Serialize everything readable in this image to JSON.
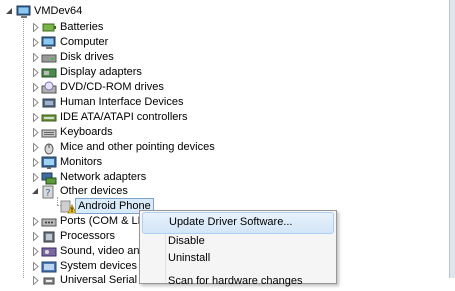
{
  "tree": {
    "root": {
      "label": "VMDev64",
      "icon": "computer-icon"
    },
    "items": [
      {
        "label": "Batteries",
        "icon": "battery-icon"
      },
      {
        "label": "Computer",
        "icon": "computer-icon"
      },
      {
        "label": "Disk drives",
        "icon": "disk-drive-icon"
      },
      {
        "label": "Display adapters",
        "icon": "display-adapter-icon"
      },
      {
        "label": "DVD/CD-ROM drives",
        "icon": "dvd-drive-icon"
      },
      {
        "label": "Human Interface Devices",
        "icon": "hid-icon"
      },
      {
        "label": "IDE ATA/ATAPI controllers",
        "icon": "ide-controller-icon"
      },
      {
        "label": "Keyboards",
        "icon": "keyboard-icon"
      },
      {
        "label": "Mice and other pointing devices",
        "icon": "mouse-icon"
      },
      {
        "label": "Monitors",
        "icon": "monitor-icon"
      },
      {
        "label": "Network adapters",
        "icon": "network-adapter-icon"
      },
      {
        "label": "Other devices",
        "icon": "other-devices-icon",
        "expanded": true
      },
      {
        "label": "Ports (COM & LPT",
        "icon": "port-icon"
      },
      {
        "label": "Processors",
        "icon": "processor-icon"
      },
      {
        "label": "Sound, video and",
        "icon": "sound-icon"
      },
      {
        "label": "System devices",
        "icon": "system-devices-icon"
      },
      {
        "label": "Universal Serial B",
        "icon": "usb-icon"
      }
    ],
    "child": {
      "label": "Android Phone",
      "icon": "warning-device-icon",
      "selected": true
    }
  },
  "context_menu": {
    "items": [
      {
        "label": "Update Driver Software...",
        "highlighted": true
      },
      {
        "label": "Disable"
      },
      {
        "label": "Uninstall"
      },
      {
        "label": "Scan for hardware changes"
      }
    ]
  },
  "colors": {
    "selection_bg": "#d9ebf9",
    "selection_border": "#7da2ce",
    "menu_bg": "#f5f5f5",
    "menu_highlight": "#d3e6f8"
  }
}
